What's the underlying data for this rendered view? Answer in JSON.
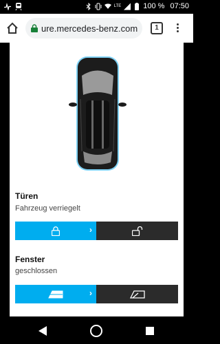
{
  "status_bar": {
    "battery": "100 %",
    "time": "07:50",
    "network": "LTE"
  },
  "browser": {
    "url": "ure.mercedes-benz.com",
    "tab_count": "1"
  },
  "doors": {
    "title": "Türen",
    "status": "Fahrzeug verriegelt",
    "lock_chevron": "›"
  },
  "windows": {
    "title": "Fenster",
    "status": "geschlossen",
    "close_chevron": "›"
  },
  "colors": {
    "accent": "#00adef",
    "dark_button": "#2b2b2b",
    "secure_green": "#188038"
  }
}
